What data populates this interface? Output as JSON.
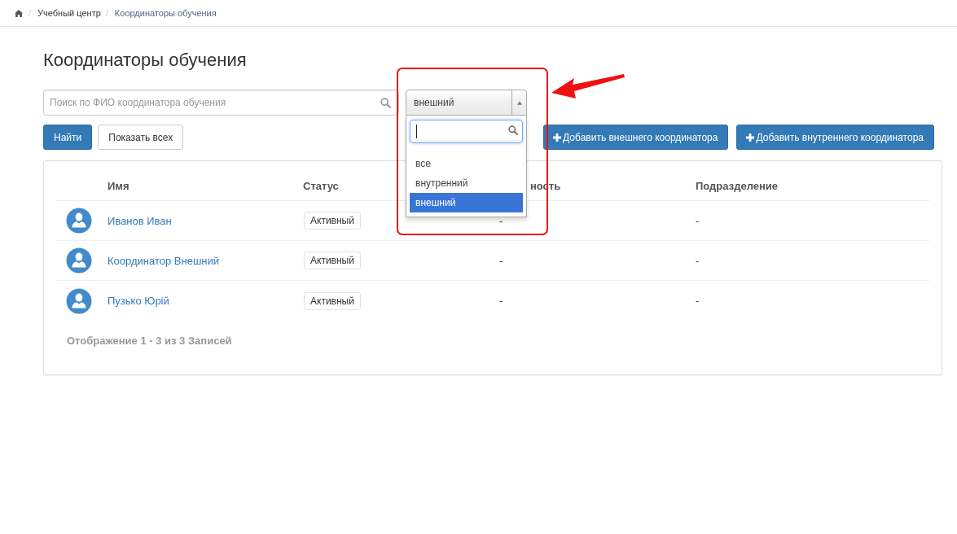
{
  "breadcrumb": [
    {
      "kind": "home"
    },
    {
      "kind": "separator",
      "label": "/"
    },
    {
      "kind": "link",
      "label": "Учебный центр"
    },
    {
      "kind": "separator",
      "label": "/"
    },
    {
      "kind": "current",
      "label": "Координаторы обучения"
    }
  ],
  "title": "Координаторы обучения",
  "search": {
    "placeholder": "Поиск по ФИО координатора обучения"
  },
  "filter": {
    "value": "внешний",
    "expanded": true,
    "dropdown_search": {
      "focused": true
    },
    "options": [
      {
        "label": "все",
        "selected": false
      },
      {
        "label": "внутренний",
        "selected": false
      },
      {
        "label": "внешний",
        "selected": true
      }
    ]
  },
  "buttons": [
    {
      "label": "Найти",
      "kind": "primary"
    },
    {
      "label": "Показать всех",
      "kind": "default"
    },
    {
      "label": "Добавить внешнего координатора",
      "kind": "add"
    },
    {
      "label": "Добавить внутреннего координатора",
      "kind": "add"
    }
  ],
  "table": {
    "columns": [
      "Имя",
      "Статус",
      "ность",
      "Подразделение"
    ],
    "rows": [
      {
        "name": "Иванов Иван",
        "status": "Активный",
        "column_3": "-",
        "subdivision": "-"
      },
      {
        "name": "Координатор Внешний",
        "status": "Активный",
        "column_3": "-",
        "subdivision": "-"
      },
      {
        "name": "Пузько Юрій",
        "status": "Активный",
        "column_3": "-",
        "subdivision": "-"
      }
    ],
    "footer": "Отображение 1 - 3 из 3 Записей"
  }
}
